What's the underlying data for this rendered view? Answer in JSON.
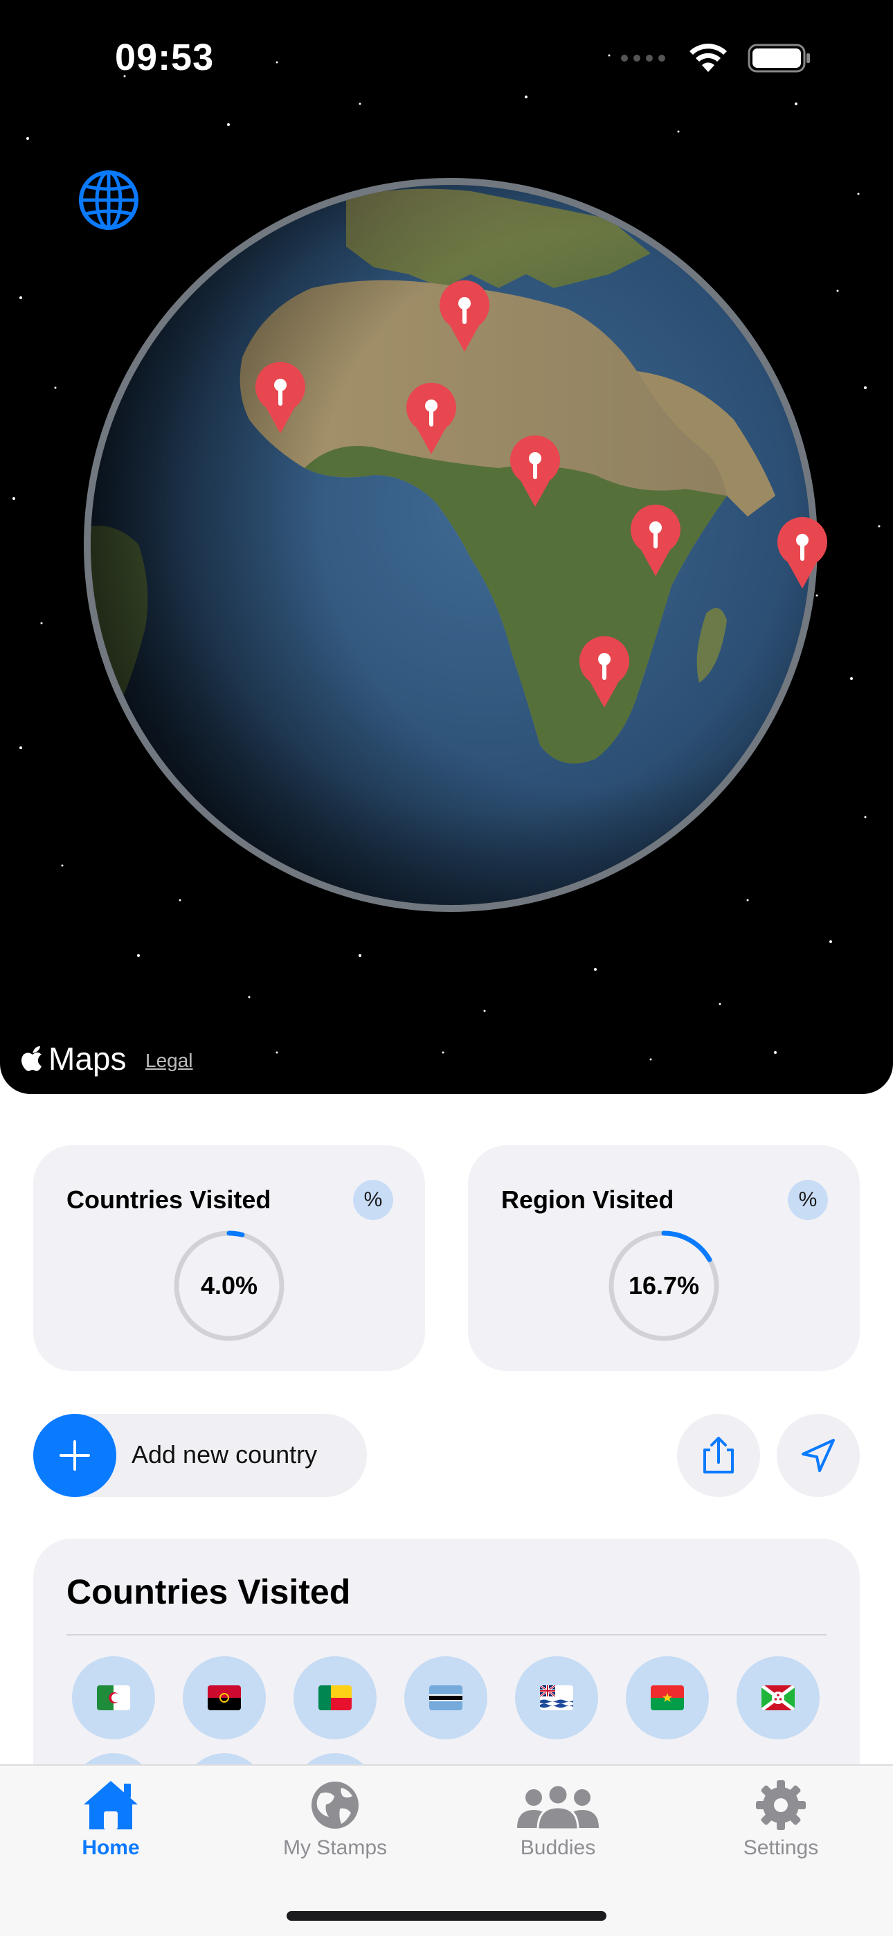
{
  "status_bar": {
    "time": "09:53"
  },
  "map": {
    "brand": "Maps",
    "legal": "Legal"
  },
  "stats": {
    "countries": {
      "title": "Countries Visited",
      "value_label": "4.0%",
      "progress": 0.04,
      "badge": "%"
    },
    "regions": {
      "title": "Region Visited",
      "value_label": "16.7%",
      "progress": 0.167,
      "badge": "%"
    }
  },
  "actions": {
    "add_label": "Add new country"
  },
  "visited": {
    "title": "Countries Visited",
    "flags": [
      "algeria-flag",
      "angola-flag",
      "benin-flag",
      "botswana-flag",
      "british-indian-ocean-territory-flag",
      "burkina-faso-flag",
      "burundi-flag"
    ]
  },
  "tabs": [
    {
      "label": "Home",
      "icon": "house-icon",
      "active": true
    },
    {
      "label": "My Stamps",
      "icon": "globe-icon",
      "active": false
    },
    {
      "label": "Buddies",
      "icon": "people-icon",
      "active": false
    },
    {
      "label": "Settings",
      "icon": "gear-icon",
      "active": false
    }
  ],
  "colors": {
    "accent": "#0a7aff",
    "pin": "#e8474f",
    "card": "#f2f2f6"
  }
}
